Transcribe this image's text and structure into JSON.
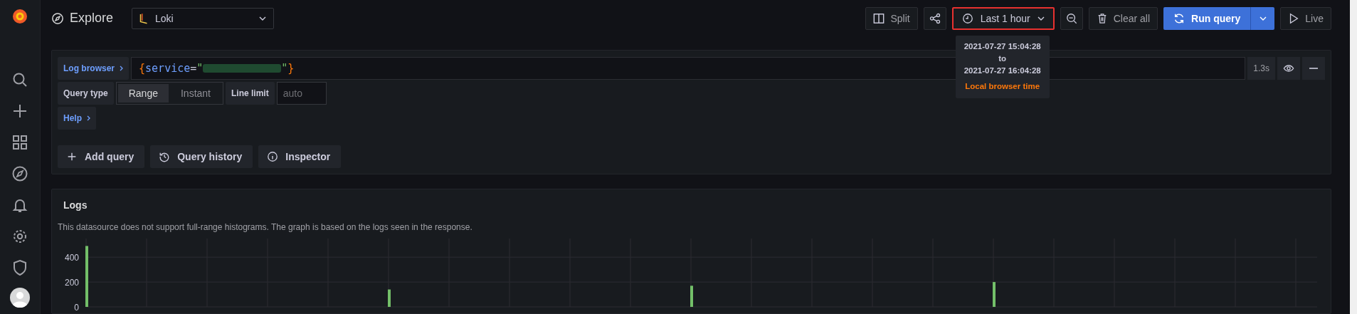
{
  "sidebar": {
    "items": [
      {
        "kind": "search"
      },
      {
        "kind": "plus"
      },
      {
        "kind": "grid"
      },
      {
        "kind": "compass"
      },
      {
        "kind": "bell"
      },
      {
        "kind": "gear"
      },
      {
        "kind": "shield"
      },
      {
        "kind": "avatar"
      }
    ]
  },
  "header": {
    "title": "Explore",
    "datasource": "Loki"
  },
  "toolbar": [
    {
      "kind": "split",
      "label": "Split"
    },
    {
      "kind": "share"
    },
    {
      "kind": "time",
      "label": "Last 1 hour",
      "highlighted": true
    },
    {
      "kind": "zoom"
    },
    {
      "kind": "clear",
      "label": "Clear all"
    },
    {
      "kind": "run",
      "label": "Run query"
    },
    {
      "kind": "live",
      "label": "Live"
    }
  ],
  "time_tooltip": {
    "from": "2021-07-27 15:04:28",
    "separator": "to",
    "to": "2021-07-27 16:04:28",
    "note": "Local browser time"
  },
  "query": {
    "browser_button": "Log browser",
    "tokens": [
      {
        "kind": "brace",
        "text": "{"
      },
      {
        "kind": "label",
        "text": "service"
      },
      {
        "kind": "op",
        "text": "="
      },
      {
        "kind": "string",
        "text": "\""
      },
      {
        "kind": "redacted"
      },
      {
        "kind": "string",
        "text": "\""
      },
      {
        "kind": "brace",
        "text": "}"
      }
    ],
    "duration": "1.3s",
    "query_type_label": "Query type",
    "query_types": [
      {
        "label": "Range",
        "selected": true
      },
      {
        "label": "Instant",
        "selected": false
      }
    ],
    "line_limit_label": "Line limit",
    "line_limit_placeholder": "auto",
    "help": "Help"
  },
  "actions": [
    {
      "kind": "plus",
      "label": "Add query"
    },
    {
      "kind": "history",
      "label": "Query history"
    },
    {
      "kind": "info",
      "label": "Inspector"
    }
  ],
  "logs": {
    "title": "Logs",
    "notice": "This datasource does not support full-range histograms. The graph is based on the logs seen in the response.",
    "chart_data": {
      "type": "bar",
      "ylim": [
        0,
        550
      ],
      "yticks": [
        0,
        200,
        400
      ],
      "grid": true,
      "series": [
        {
          "color": "#73bf69",
          "values": [
            490,
            140,
            170,
            200
          ]
        }
      ]
    }
  }
}
